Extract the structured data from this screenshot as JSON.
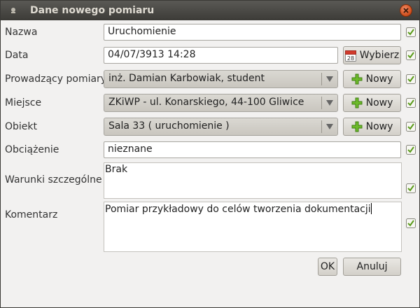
{
  "window": {
    "title": "Dane nowego pomiaru"
  },
  "labels": {
    "nazwa": "Nazwa",
    "data": "Data",
    "prowadzacy": "Prowadzący pomiary",
    "miejsce": "Miejsce",
    "obiekt": "Obiekt",
    "obciazenie": "Obciążenie",
    "warunki": "Warunki szczególne",
    "komentarz": "Komentarz"
  },
  "fields": {
    "nazwa": "Uruchomienie",
    "data": "04/07/3913 14:28",
    "prowadzacy": "inż. Damian Karbowiak, student",
    "miejsce": "ZKiWP - ul. Konarskiego, 44-100 Gliwice",
    "obiekt": "Sala 33 ( uruchomienie )",
    "obciazenie": "nieznane",
    "warunki": "Brak",
    "komentarz": "Pomiar przykładowy do celów tworzenia dokumentacji"
  },
  "buttons": {
    "wybierz": "Wybierz",
    "calendar_day": "28",
    "nowy": "Nowy",
    "ok": "OK",
    "anuluj": "Anuluj"
  },
  "colors": {
    "check_green": "#5a9b1a",
    "plus_green": "#6dbb2b"
  },
  "icons": {
    "calendar": "calendar-icon",
    "plus": "plus-icon",
    "check": "check-icon",
    "close": "close-icon"
  }
}
